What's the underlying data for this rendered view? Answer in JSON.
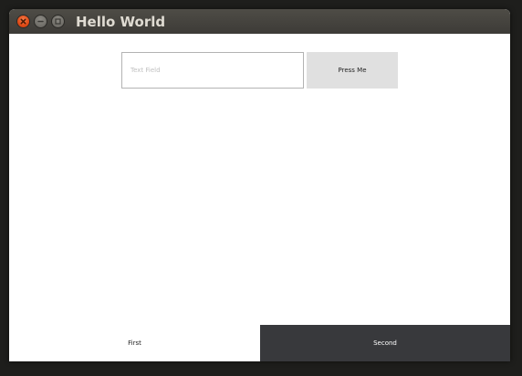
{
  "window": {
    "title": "Hello World",
    "controls": {
      "close_icon": "close-icon",
      "minimize_icon": "minimize-icon",
      "maximize_icon": "maximize-icon"
    }
  },
  "form": {
    "text_field": {
      "placeholder": "Text Field",
      "value": ""
    },
    "button_label": "Press Me"
  },
  "tabs": [
    {
      "label": "First",
      "selected": false
    },
    {
      "label": "Second",
      "selected": true
    }
  ],
  "colors": {
    "close_button": "#df4a16",
    "titlebar": "#3d3b37",
    "button_bg": "#e0e0e0",
    "selected_tab_bg": "#38393c"
  }
}
